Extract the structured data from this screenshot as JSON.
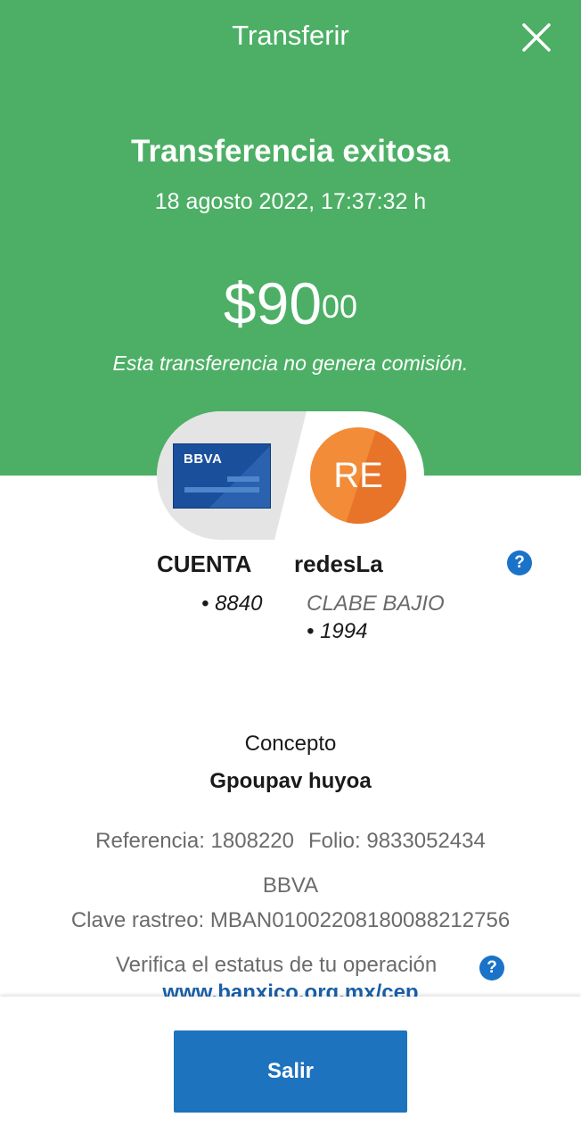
{
  "header": {
    "title": "Transferir",
    "success_title": "Transferencia exitosa",
    "datetime": "18 agosto 2022, 17:37:32 h",
    "amount_main": "$90",
    "amount_cents": "00",
    "commission_note": "Esta transferencia no genera comisión.",
    "close_icon": "close-icon",
    "background_color": "#4caf65"
  },
  "transfer": {
    "from": {
      "card_brand": "BBVA",
      "name": "CUENTA",
      "account": "• 8840"
    },
    "to": {
      "avatar_initials": "RE",
      "avatar_color": "#f28c38",
      "name": "redesLa",
      "bank": "CLABE BAJIO",
      "account": "• 1994"
    },
    "help_icon": "question-icon"
  },
  "details": {
    "concept_label": "Concepto",
    "concept_value": "Gpoupav huyoa",
    "reference": "Referencia: 1808220",
    "folio": "Folio: 9833052434",
    "bank": "BBVA",
    "tracking_key": "Clave rastreo: MBAN01002208180088212756",
    "verify_text": "Verifica el estatus de tu operación",
    "verify_link": "www.banxico.org.mx/cep"
  },
  "footer": {
    "exit_label": "Salir",
    "button_color": "#1d73be"
  }
}
